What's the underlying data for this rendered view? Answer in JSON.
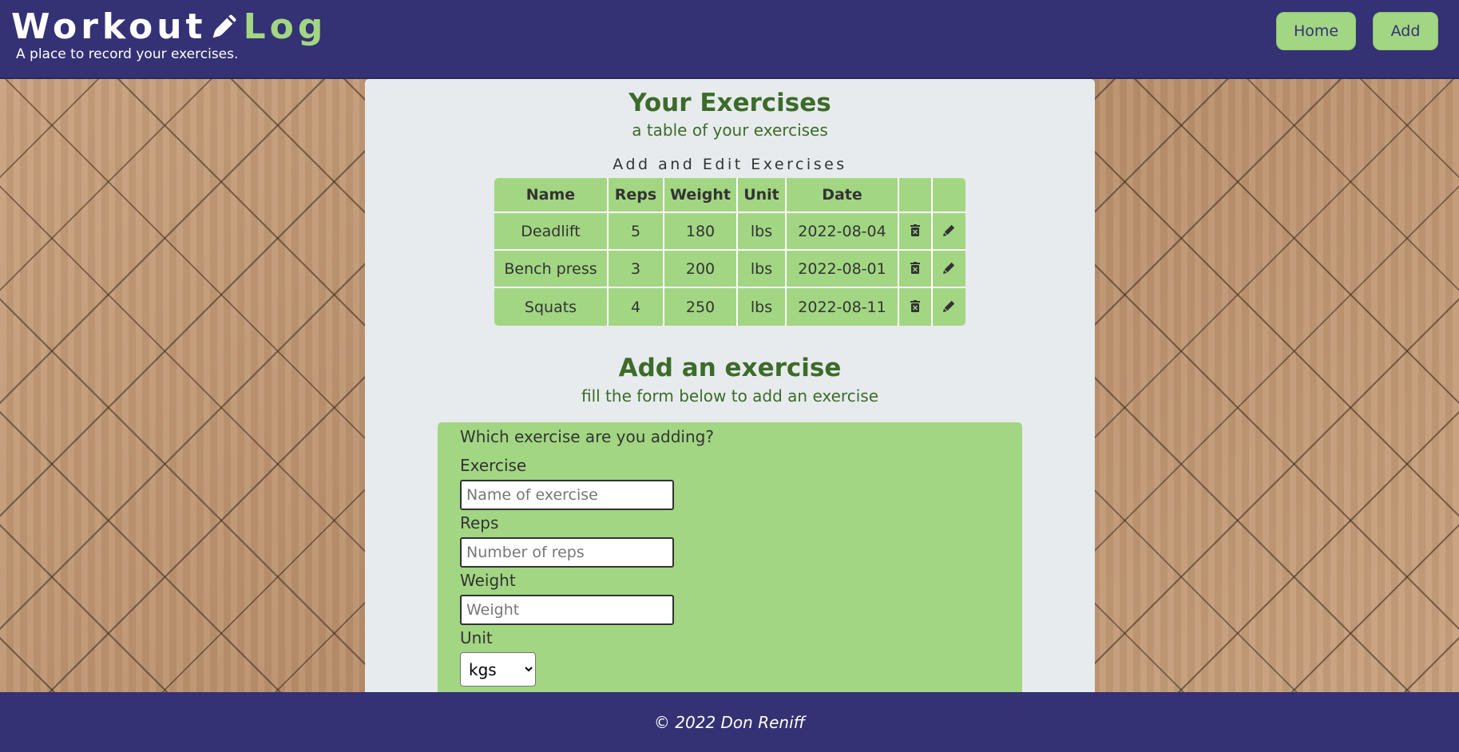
{
  "header": {
    "title_part1": "Workout",
    "title_part2": "Log",
    "title_icon": "pencil-icon",
    "tagline": "A place to record your exercises.",
    "nav": {
      "home_label": "Home",
      "add_label": "Add"
    }
  },
  "exercises_section": {
    "title": "Your Exercises",
    "subtitle": "a table of your exercises",
    "caption": "Add and Edit Exercises",
    "columns": [
      "Name",
      "Reps",
      "Weight",
      "Unit",
      "Date"
    ],
    "delete_icon": "trash-icon",
    "edit_icon": "pencil-icon",
    "rows": [
      {
        "name": "Deadlift",
        "reps": "5",
        "weight": "180",
        "unit": "lbs",
        "date": "2022-08-04"
      },
      {
        "name": "Bench press",
        "reps": "3",
        "weight": "200",
        "unit": "lbs",
        "date": "2022-08-01"
      },
      {
        "name": "Squats",
        "reps": "4",
        "weight": "250",
        "unit": "lbs",
        "date": "2022-08-11"
      }
    ]
  },
  "add_section": {
    "title": "Add an exercise",
    "subtitle": "fill the form below to add an exercise",
    "form": {
      "legend": "Which exercise are you adding?",
      "exercise_label": "Exercise",
      "exercise_placeholder": "Name of exercise",
      "exercise_value": "",
      "reps_label": "Reps",
      "reps_placeholder": "Number of reps",
      "reps_value": "",
      "weight_label": "Weight",
      "weight_placeholder": "Weight",
      "weight_value": "",
      "unit_label": "Unit",
      "unit_selected": "kgs"
    }
  },
  "footer": {
    "text": "© 2022 Don Reniff"
  },
  "colors": {
    "header_bg": "#343174",
    "accent_green": "#a2d683",
    "heading_green": "#3c6b2a",
    "panel_bg": "#e7ebed"
  }
}
